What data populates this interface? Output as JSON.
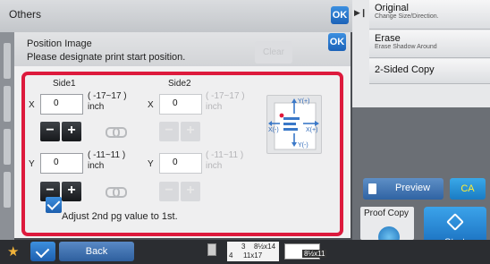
{
  "background": {
    "title": "Others",
    "ok_label": "OK"
  },
  "right_menu": {
    "items": [
      {
        "title": "Original",
        "subtitle": "Change Size/Direction."
      },
      {
        "title": "Erase",
        "subtitle": "Erase Shadow Around"
      },
      {
        "title": "2-Sided Copy",
        "subtitle": ""
      }
    ],
    "preview_label": "Preview",
    "ca_label": "CA",
    "proof_copy_label": "Proof Copy",
    "start_label": "Start"
  },
  "bottom_bar": {
    "back_label": "Back",
    "paper_slots": [
      {
        "tray": "3",
        "size": "8½x14"
      },
      {
        "tray": "4",
        "size": "11x17"
      }
    ],
    "paper_b_size": "8½x11"
  },
  "dialog": {
    "title": "Position Image",
    "instruction": "Please designate print start position.",
    "clear_label": "Clear",
    "ok_label": "OK",
    "side1_label": "Side1",
    "side2_label": "Side2",
    "x_label": "X",
    "y_label": "Y",
    "side1_x_value": "0",
    "side1_y_value": "0",
    "side2_x_value": "0",
    "side2_y_value": "0",
    "x_range": "( -17~17 )",
    "y_range": "( -11~11 )",
    "unit": "inch",
    "minus_label": "−",
    "plus_label": "+",
    "adjust_label": "Adjust 2nd pg value to 1st.",
    "adjust_checked": true,
    "diagram": {
      "y_plus": "Y(+)",
      "y_minus": "Y(-)",
      "x_plus": "X(+)",
      "x_minus": "X(-)"
    }
  },
  "colors": {
    "accent_blue": "#1d6fc4",
    "frame_red": "#dd1a3d",
    "star": "#f0b23a"
  }
}
